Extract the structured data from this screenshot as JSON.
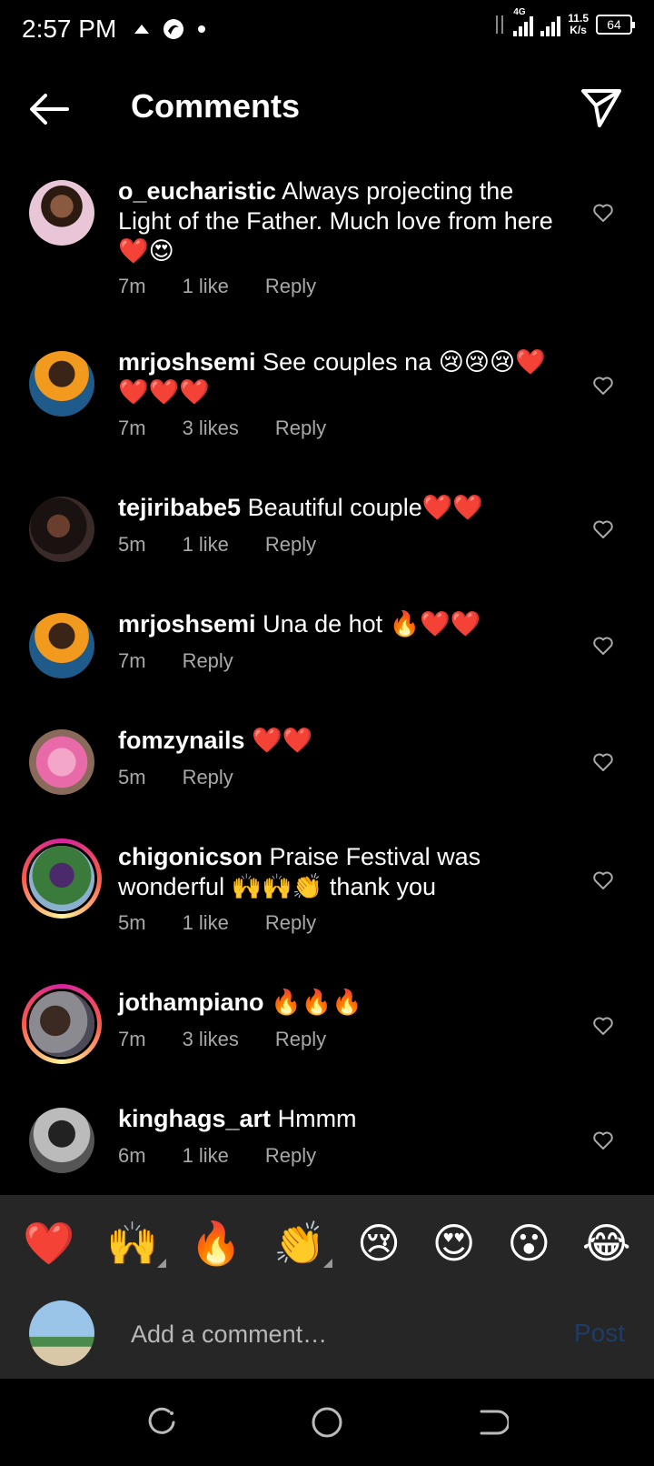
{
  "status_bar": {
    "time": "2:57 PM",
    "network": "4G",
    "speed_value": "11.5",
    "speed_unit": "K/s",
    "battery": "64"
  },
  "header": {
    "title": "Comments"
  },
  "comments": [
    {
      "username": "o_eucharistic",
      "text": "Always projecting the Light of the Father. Much love from here ❤️😍",
      "time": "7m",
      "likes": "1 like",
      "reply": "Reply"
    },
    {
      "username": "mrjoshsemi",
      "text": "See couples na 😢😢😢❤️❤️❤️❤️",
      "time": "7m",
      "likes": "3 likes",
      "reply": "Reply"
    },
    {
      "username": "tejiribabe5",
      "text": "Beautiful couple❤️❤️",
      "time": "5m",
      "likes": "1 like",
      "reply": "Reply"
    },
    {
      "username": "mrjoshsemi",
      "text": "Una de hot 🔥❤️❤️",
      "time": "7m",
      "likes": "",
      "reply": "Reply"
    },
    {
      "username": "fomzynails",
      "text": "❤️❤️",
      "time": "5m",
      "likes": "",
      "reply": "Reply"
    },
    {
      "username": "chigonicson",
      "text": "Praise Festival was wonderful 🙌🙌👏 thank you",
      "time": "5m",
      "likes": "1 like",
      "reply": "Reply"
    },
    {
      "username": "jothampiano",
      "text": "🔥🔥🔥",
      "time": "7m",
      "likes": "3 likes",
      "reply": "Reply"
    },
    {
      "username": "kinghags_art",
      "text": "Hmmm",
      "time": "6m",
      "likes": "1 like",
      "reply": "Reply"
    }
  ],
  "emoji_bar": [
    "❤️",
    "🙌",
    "🔥",
    "👏",
    "😢",
    "😍",
    "😮",
    "😂"
  ],
  "composer": {
    "placeholder": "Add a comment…",
    "post_label": "Post"
  },
  "colors": {
    "background": "#000000",
    "panel": "#262626",
    "secondary_text": "#a8a8a8",
    "post_disabled": "#1d3d66"
  }
}
